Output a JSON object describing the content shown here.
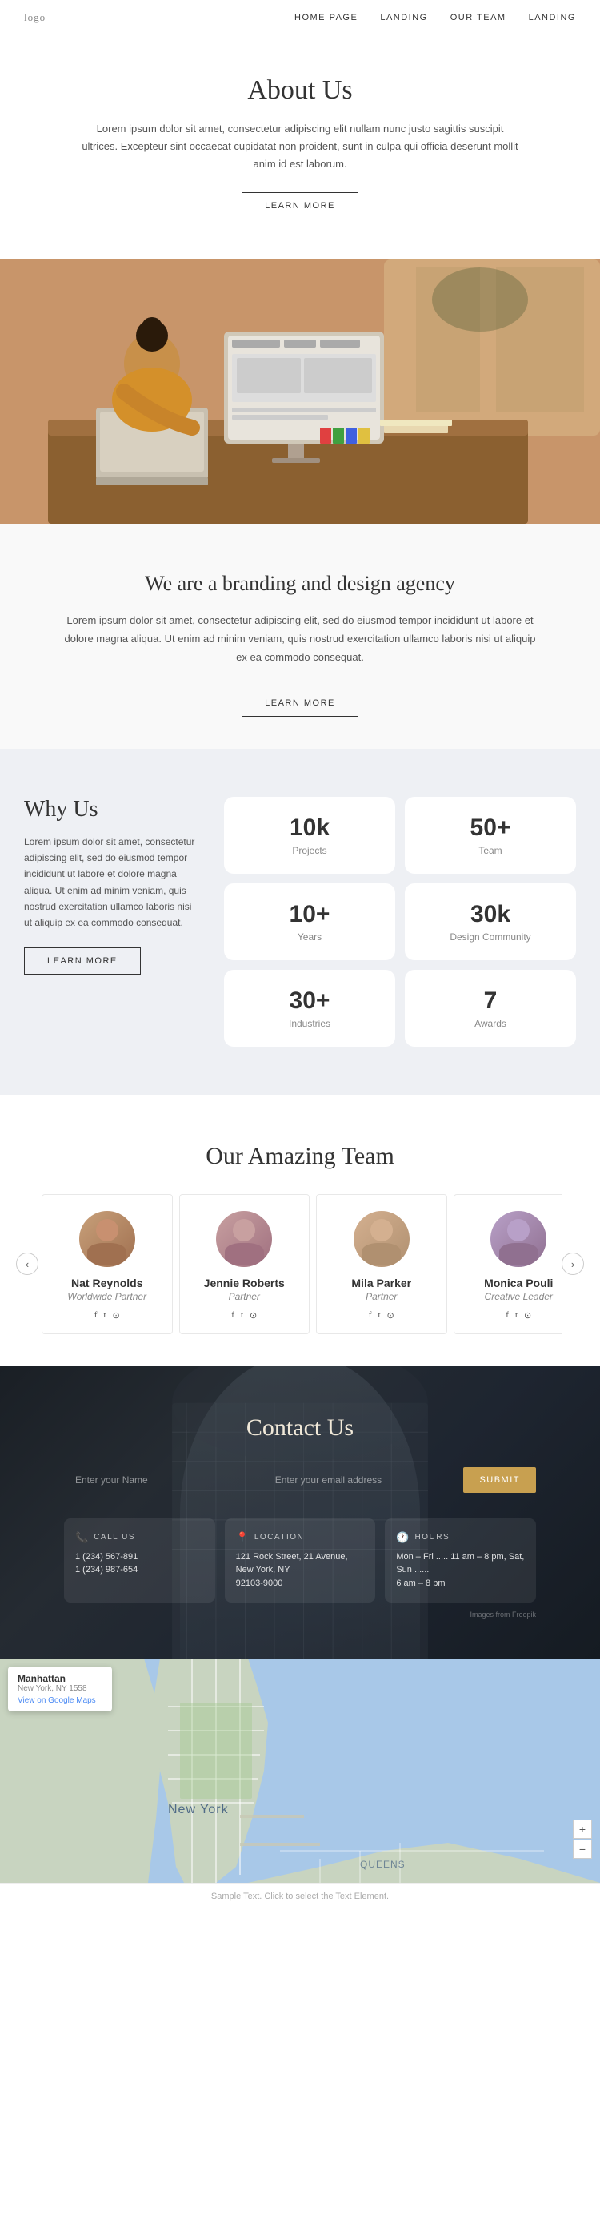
{
  "nav": {
    "logo": "logo",
    "links": [
      "HOME PAGE",
      "LANDING",
      "OUR TEAM",
      "LANDING"
    ]
  },
  "about": {
    "title": "About Us",
    "body": "Lorem ipsum dolor sit amet, consectetur adipiscing elit nullam nunc justo sagittis suscipit ultrices. Excepteur sint occaecat cupidatat non proident, sunt in culpa qui officia deserunt mollit anim id est laborum.",
    "cta": "LEARN MORE"
  },
  "branding": {
    "title": "We are a branding and design agency",
    "body": "Lorem ipsum dolor sit amet, consectetur adipiscing elit, sed do eiusmod tempor incididunt ut labore et dolore magna aliqua. Ut enim ad minim veniam, quis nostrud exercitation ullamco laboris nisi ut aliquip ex ea commodo consequat.",
    "cta": "LEARN MORE"
  },
  "why_us": {
    "title": "Why Us",
    "body": "Lorem ipsum dolor sit amet, consectetur adipiscing elit, sed do eiusmod tempor incididunt ut labore et dolore magna aliqua. Ut enim ad minim veniam, quis nostrud exercitation ullamco laboris nisi ut aliquip ex ea commodo consequat.",
    "cta": "LEARN MORE",
    "stats": [
      {
        "number": "10k",
        "label": "Projects"
      },
      {
        "number": "50+",
        "label": "Team"
      },
      {
        "number": "10+",
        "label": "Years"
      },
      {
        "number": "30k",
        "label": "Design Community"
      },
      {
        "number": "30+",
        "label": "Industries"
      },
      {
        "number": "7",
        "label": "Awards"
      }
    ]
  },
  "team": {
    "section_title": "Our Amazing Team",
    "members": [
      {
        "name": "Nat Reynolds",
        "role": "Worldwide Partner",
        "avatar_class": "avatar-nat",
        "head_color": "#c89070",
        "body_color": "#a07050"
      },
      {
        "name": "Jennie Roberts",
        "role": "Partner",
        "avatar_class": "avatar-jennie",
        "head_color": "#c8a0a0",
        "body_color": "#a07080"
      },
      {
        "name": "Mila Parker",
        "role": "Partner",
        "avatar_class": "avatar-mila",
        "head_color": "#d4b090",
        "body_color": "#b09070"
      },
      {
        "name": "Monica Pouli",
        "role": "Creative Leader",
        "avatar_class": "avatar-monica",
        "head_color": "#b8a0c8",
        "body_color": "#907090"
      }
    ],
    "social_icons": [
      "f",
      "t",
      "o"
    ]
  },
  "contact": {
    "title": "Contact Us",
    "form": {
      "name_placeholder": "Enter your Name",
      "email_placeholder": "Enter your email address",
      "submit_label": "SUBMIT"
    },
    "info_cards": [
      {
        "icon": "📞",
        "title": "CALL US",
        "lines": [
          "1 (234) 567-891",
          "1 (234) 987-654"
        ]
      },
      {
        "icon": "📍",
        "title": "LOCATION",
        "lines": [
          "121 Rock Street, 21 Avenue, New York, NY",
          "92103-9000"
        ]
      },
      {
        "icon": "🕐",
        "title": "HOURS",
        "lines": [
          "Mon – Fri ..... 11 am – 8 pm, Sat, Sun ......",
          "6 am – 8 pm"
        ]
      }
    ],
    "image_credit": "Images from Freepik"
  },
  "map": {
    "city": "Manhattan",
    "state": "New York, NY 1558",
    "view_link": "View on Google Maps",
    "center_label": "New York",
    "borough_label": "QUEENS"
  },
  "footer": {
    "sample_text": "Sample Text. Click to select the Text Element."
  }
}
